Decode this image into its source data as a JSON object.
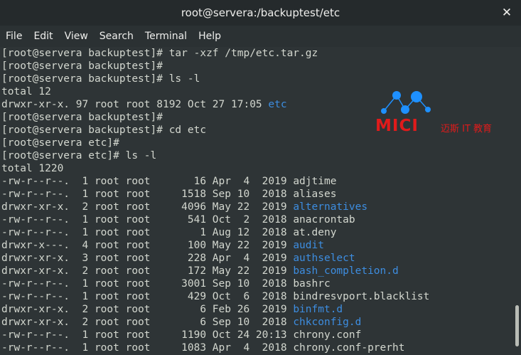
{
  "window": {
    "title": "root@servera:/backuptest/etc",
    "close_glyph": "✕"
  },
  "menu": [
    "File",
    "Edit",
    "View",
    "Search",
    "Terminal",
    "Help"
  ],
  "colors": {
    "background": "#2e3436",
    "text": "#d3d7cf",
    "directory": "#3d8de0",
    "watermark": "#e01b1b"
  },
  "watermark": {
    "brand": "MICI",
    "subtitle": "迈斯 IT 教育"
  },
  "terminal": {
    "lines": [
      {
        "text": "[root@servera backuptest]# tar -xzf /tmp/etc.tar.gz"
      },
      {
        "text": "[root@servera backuptest]#"
      },
      {
        "text": "[root@servera backuptest]# ls -l"
      },
      {
        "text": "total 12"
      },
      {
        "text": "drwxr-xr-x. 97 root root 8192 Oct 27 17:05 ",
        "name": "etc",
        "dir": true
      },
      {
        "text": "[root@servera backuptest]#"
      },
      {
        "text": "[root@servera backuptest]# cd etc"
      },
      {
        "text": "[root@servera etc]#"
      },
      {
        "text": "[root@servera etc]# ls -l"
      },
      {
        "text": "total 1220"
      },
      {
        "text": "-rw-r--r--.  1 root root       16 Apr  4  2019 ",
        "name": "adjtime",
        "dir": false
      },
      {
        "text": "-rw-r--r--.  1 root root     1518 Sep 10  2018 ",
        "name": "aliases",
        "dir": false
      },
      {
        "text": "drwxr-xr-x.  2 root root     4096 May 22  2019 ",
        "name": "alternatives",
        "dir": true
      },
      {
        "text": "-rw-r--r--.  1 root root      541 Oct  2  2018 ",
        "name": "anacrontab",
        "dir": false
      },
      {
        "text": "-rw-r--r--.  1 root root        1 Aug 12  2018 ",
        "name": "at.deny",
        "dir": false
      },
      {
        "text": "drwxr-x---.  4 root root      100 May 22  2019 ",
        "name": "audit",
        "dir": true
      },
      {
        "text": "drwxr-xr-x.  3 root root      228 Apr  4  2019 ",
        "name": "authselect",
        "dir": true
      },
      {
        "text": "drwxr-xr-x.  2 root root      172 May 22  2019 ",
        "name": "bash_completion.d",
        "dir": true
      },
      {
        "text": "-rw-r--r--.  1 root root     3001 Sep 10  2018 ",
        "name": "bashrc",
        "dir": false
      },
      {
        "text": "-rw-r--r--.  1 root root      429 Oct  6  2018 ",
        "name": "bindresvport.blacklist",
        "dir": false
      },
      {
        "text": "drwxr-xr-x.  2 root root        6 Feb 26  2019 ",
        "name": "binfmt.d",
        "dir": true
      },
      {
        "text": "drwxr-xr-x.  2 root root        6 Sep 10  2018 ",
        "name": "chkconfig.d",
        "dir": true
      },
      {
        "text": "-rw-r--r--.  1 root root     1190 Oct 24 20:13 ",
        "name": "chrony.conf",
        "dir": false
      },
      {
        "text": "-rw-r--r--.  1 root root     1083 Apr  4  2018 ",
        "name": "chrony.conf-prerht",
        "dir": false
      }
    ]
  }
}
